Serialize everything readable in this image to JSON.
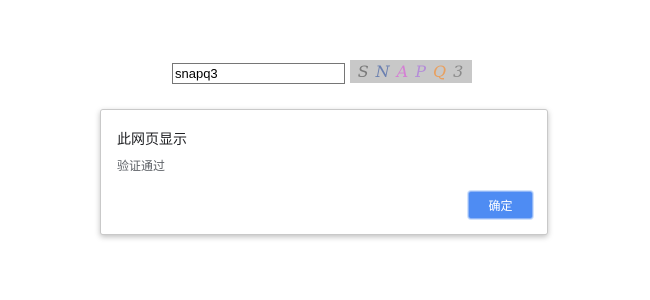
{
  "captcha": {
    "input_value": "snapq3",
    "image_chars": [
      {
        "char": "S",
        "color": "#7a7a7a"
      },
      {
        "char": "N",
        "color": "#6a7fb0"
      },
      {
        "char": "A",
        "color": "#d47fd4"
      },
      {
        "char": "P",
        "color": "#b48cd8"
      },
      {
        "char": "Q",
        "color": "#e8a060"
      },
      {
        "char": "3",
        "color": "#8a8a8a"
      }
    ]
  },
  "dialog": {
    "title": "此网页显示",
    "message": "验证通过",
    "ok_label": "确定"
  },
  "colors": {
    "button_accent": "#4e8cf3",
    "captcha_background": "#c8c8c8"
  }
}
